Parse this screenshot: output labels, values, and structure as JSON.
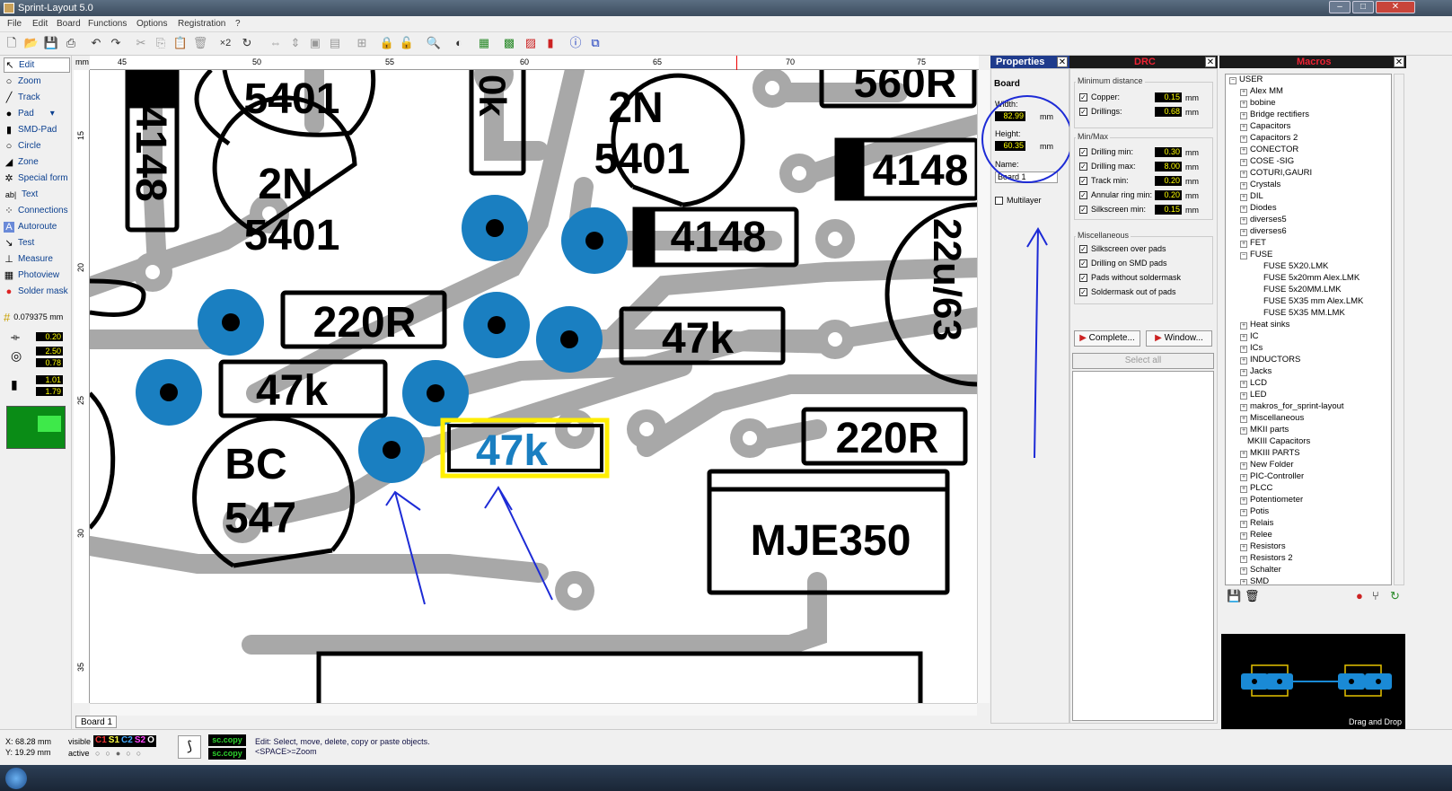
{
  "window": {
    "title": "Sprint-Layout 5.0"
  },
  "menu": [
    "File",
    "Edit",
    "Board",
    "Functions",
    "Options",
    "Registration",
    "?"
  ],
  "toolbar": {
    "icons": [
      "new-icon",
      "open-icon",
      "save-icon",
      "print-icon",
      "undo-icon",
      "redo-icon",
      "cut-icon",
      "copy-icon",
      "paste-icon",
      "delete-icon",
      "duplicate-icon",
      "rotate-icon",
      "mirror-h-icon",
      "mirror-v-icon",
      "group-icon",
      "ungroup-icon",
      "align-icon",
      "lock-icon",
      "unlock-icon",
      "zoom-icon",
      "layer-icon",
      "drc-icon",
      "component-icon",
      "drc-check-icon",
      "export-icon",
      "info-icon",
      "crop-icon"
    ],
    "multiplier": "×2"
  },
  "tools": [
    {
      "label": "Edit",
      "icon": "cursor-icon"
    },
    {
      "label": "Zoom",
      "icon": "magnifier-icon"
    },
    {
      "label": "Track",
      "icon": "track-icon"
    },
    {
      "label": "Pad",
      "icon": "pad-icon"
    },
    {
      "label": "SMD-Pad",
      "icon": "smd-pad-icon"
    },
    {
      "label": "Circle",
      "icon": "circle-icon"
    },
    {
      "label": "Zone",
      "icon": "zone-icon"
    },
    {
      "label": "Special form",
      "icon": "special-form-icon"
    },
    {
      "label": "Text",
      "icon": "text-icon"
    },
    {
      "label": "Connections",
      "icon": "connections-icon"
    },
    {
      "label": "Autoroute",
      "icon": "autoroute-icon"
    },
    {
      "label": "Test",
      "icon": "test-icon"
    },
    {
      "label": "Measure",
      "icon": "measure-icon"
    },
    {
      "label": "Photoview",
      "icon": "photoview-icon"
    },
    {
      "label": "Solder mask",
      "icon": "solder-mask-icon"
    }
  ],
  "grid": {
    "value": "0.079375 mm"
  },
  "tool_values": {
    "track_width": "0.20",
    "pad_outer": "2.50",
    "pad_inner": "0.78",
    "smd_w": "1.01",
    "smd_h": "1.79"
  },
  "ruler": {
    "unit": "mm",
    "top_ticks": [
      "45",
      "50",
      "55",
      "60",
      "65",
      "70",
      "75"
    ],
    "left_ticks": [
      "15",
      "20",
      "25",
      "30",
      "35"
    ]
  },
  "board_tab": "Board 1",
  "pcb": {
    "labels": [
      {
        "text": "5401"
      },
      {
        "text": "4148"
      },
      {
        "text": "0k"
      },
      {
        "text": "2N"
      },
      {
        "text": "5401"
      },
      {
        "text": "560R"
      },
      {
        "text": "2N"
      },
      {
        "text": "5401"
      },
      {
        "text": "4148"
      },
      {
        "text": "4148"
      },
      {
        "text": "22u/63"
      },
      {
        "text": "220R"
      },
      {
        "text": "47k"
      },
      {
        "text": "47k"
      },
      {
        "text": "47k"
      },
      {
        "text": "220R"
      },
      {
        "text": "BC"
      },
      {
        "text": "547"
      },
      {
        "text": "MJE350"
      }
    ]
  },
  "properties": {
    "title": "Properties",
    "section": "Board",
    "width_label": "Width:",
    "width_value": "82.99",
    "width_unit": "mm",
    "height_label": "Height:",
    "height_value": "60.35",
    "height_unit": "mm",
    "name_label": "Name:",
    "name_value": "Board 1",
    "multilayer": "Multilayer"
  },
  "drc": {
    "title": "DRC",
    "min_distance": "Minimum distance",
    "copper": {
      "label": "Copper:",
      "value": "0.15",
      "unit": "mm"
    },
    "drillings": {
      "label": "Drillings:",
      "value": "0.68",
      "unit": "mm"
    },
    "minmax": "Min/Max",
    "drill_min": {
      "label": "Drilling min:",
      "value": "0.30",
      "unit": "mm"
    },
    "drill_max": {
      "label": "Drilling max:",
      "value": "8.00",
      "unit": "mm"
    },
    "track_min": {
      "label": "Track min:",
      "value": "0.20",
      "unit": "mm"
    },
    "annular_min": {
      "label": "Annular ring min:",
      "value": "0.20",
      "unit": "mm"
    },
    "silk_min": {
      "label": "Silkscreen min:",
      "value": "0.15",
      "unit": "mm"
    },
    "misc": "Miscellaneous",
    "misc_items": [
      "Silkscreen over pads",
      "Drilling on SMD pads",
      "Pads without soldermask",
      "Soldermask out of pads"
    ],
    "complete_btn": "Complete...",
    "window_btn": "Window...",
    "select_all": "Select all"
  },
  "macros": {
    "title": "Macros",
    "root": "USER",
    "items": [
      "Alex MM",
      "bobine",
      "Bridge rectifiers",
      "Capacitors",
      "Capacitors 2",
      "CONECTOR",
      "COSE -SIG",
      "COTURI,GAURI",
      "Crystals",
      "DIL",
      "Diodes",
      "diverses5",
      "diverses6",
      "FET",
      "FUSE"
    ],
    "fuse_children": [
      "FUSE 5X20.LMK",
      "FUSE 5x20mm Alex.LMK",
      "FUSE 5x20MM.LMK",
      "FUSE 5X35 mm Alex.LMK",
      "FUSE 5X35 MM.LMK"
    ],
    "items2": [
      "Heat sinks",
      "IC",
      "ICs",
      "INDUCTORS",
      "Jacks",
      "LCD",
      "LED",
      "makros_for_sprint-layout",
      "Miscellaneous",
      "MKII parts",
      "MKIII Capacitors",
      "MKIII PARTS",
      "New Folder",
      "PIC-Controller",
      "PLCC",
      "Potentiometer",
      "Potis",
      "Relais",
      "Relee",
      "Resistors",
      "Resistors 2",
      "Schalter",
      "SMD"
    ],
    "preview_caption": "Drag and Drop"
  },
  "status": {
    "x": "X:   68.28 mm",
    "y": "Y:   19.29 mm",
    "visible": "visible",
    "active": "active",
    "layers": [
      "C1",
      "S1",
      "C2",
      "S2",
      "O"
    ],
    "copy_top": "sc.copy",
    "copy_bottom": "sc.copy",
    "hint1": "Edit: Select, move, delete, copy or paste objects.",
    "hint2": "<SPACE>=Zoom"
  },
  "colors": {
    "pad": "#1a7fc1",
    "track": "#a8a8a8",
    "highlight": "#ffee00",
    "annotation": "#1d2bd6"
  }
}
